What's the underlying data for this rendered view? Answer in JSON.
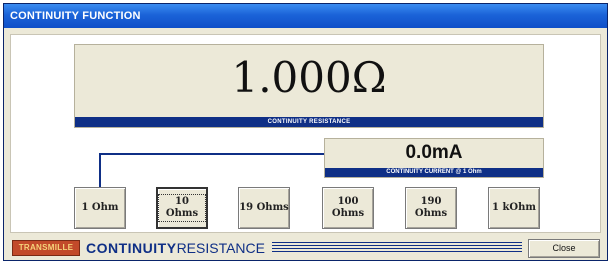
{
  "window": {
    "title": "CONTINUITY FUNCTION"
  },
  "main_display": {
    "value": "1.000Ω",
    "label": "CONTINUITY RESISTANCE"
  },
  "current_display": {
    "value": "0.0mA",
    "label": "CONTINUITY CURRENT @ 1 Ohm"
  },
  "ranges": {
    "selected": "10 Ohms",
    "buttons": [
      {
        "label": "1 Ohm"
      },
      {
        "label": "10 Ohms"
      },
      {
        "label": "19 Ohms"
      },
      {
        "label": "100 Ohms"
      },
      {
        "label": "190 Ohms"
      },
      {
        "label": "1 kOhm"
      }
    ]
  },
  "footer": {
    "logo_text": "TRANSMILLE",
    "brand_bold": "CONTINUITY",
    "brand_light": "RESISTANCE",
    "close_label": "Close"
  },
  "colors": {
    "title_bar": "#1b63d8",
    "accent": "#0f2f86",
    "panel": "#ece9d8",
    "logo": "#c24a2a"
  }
}
